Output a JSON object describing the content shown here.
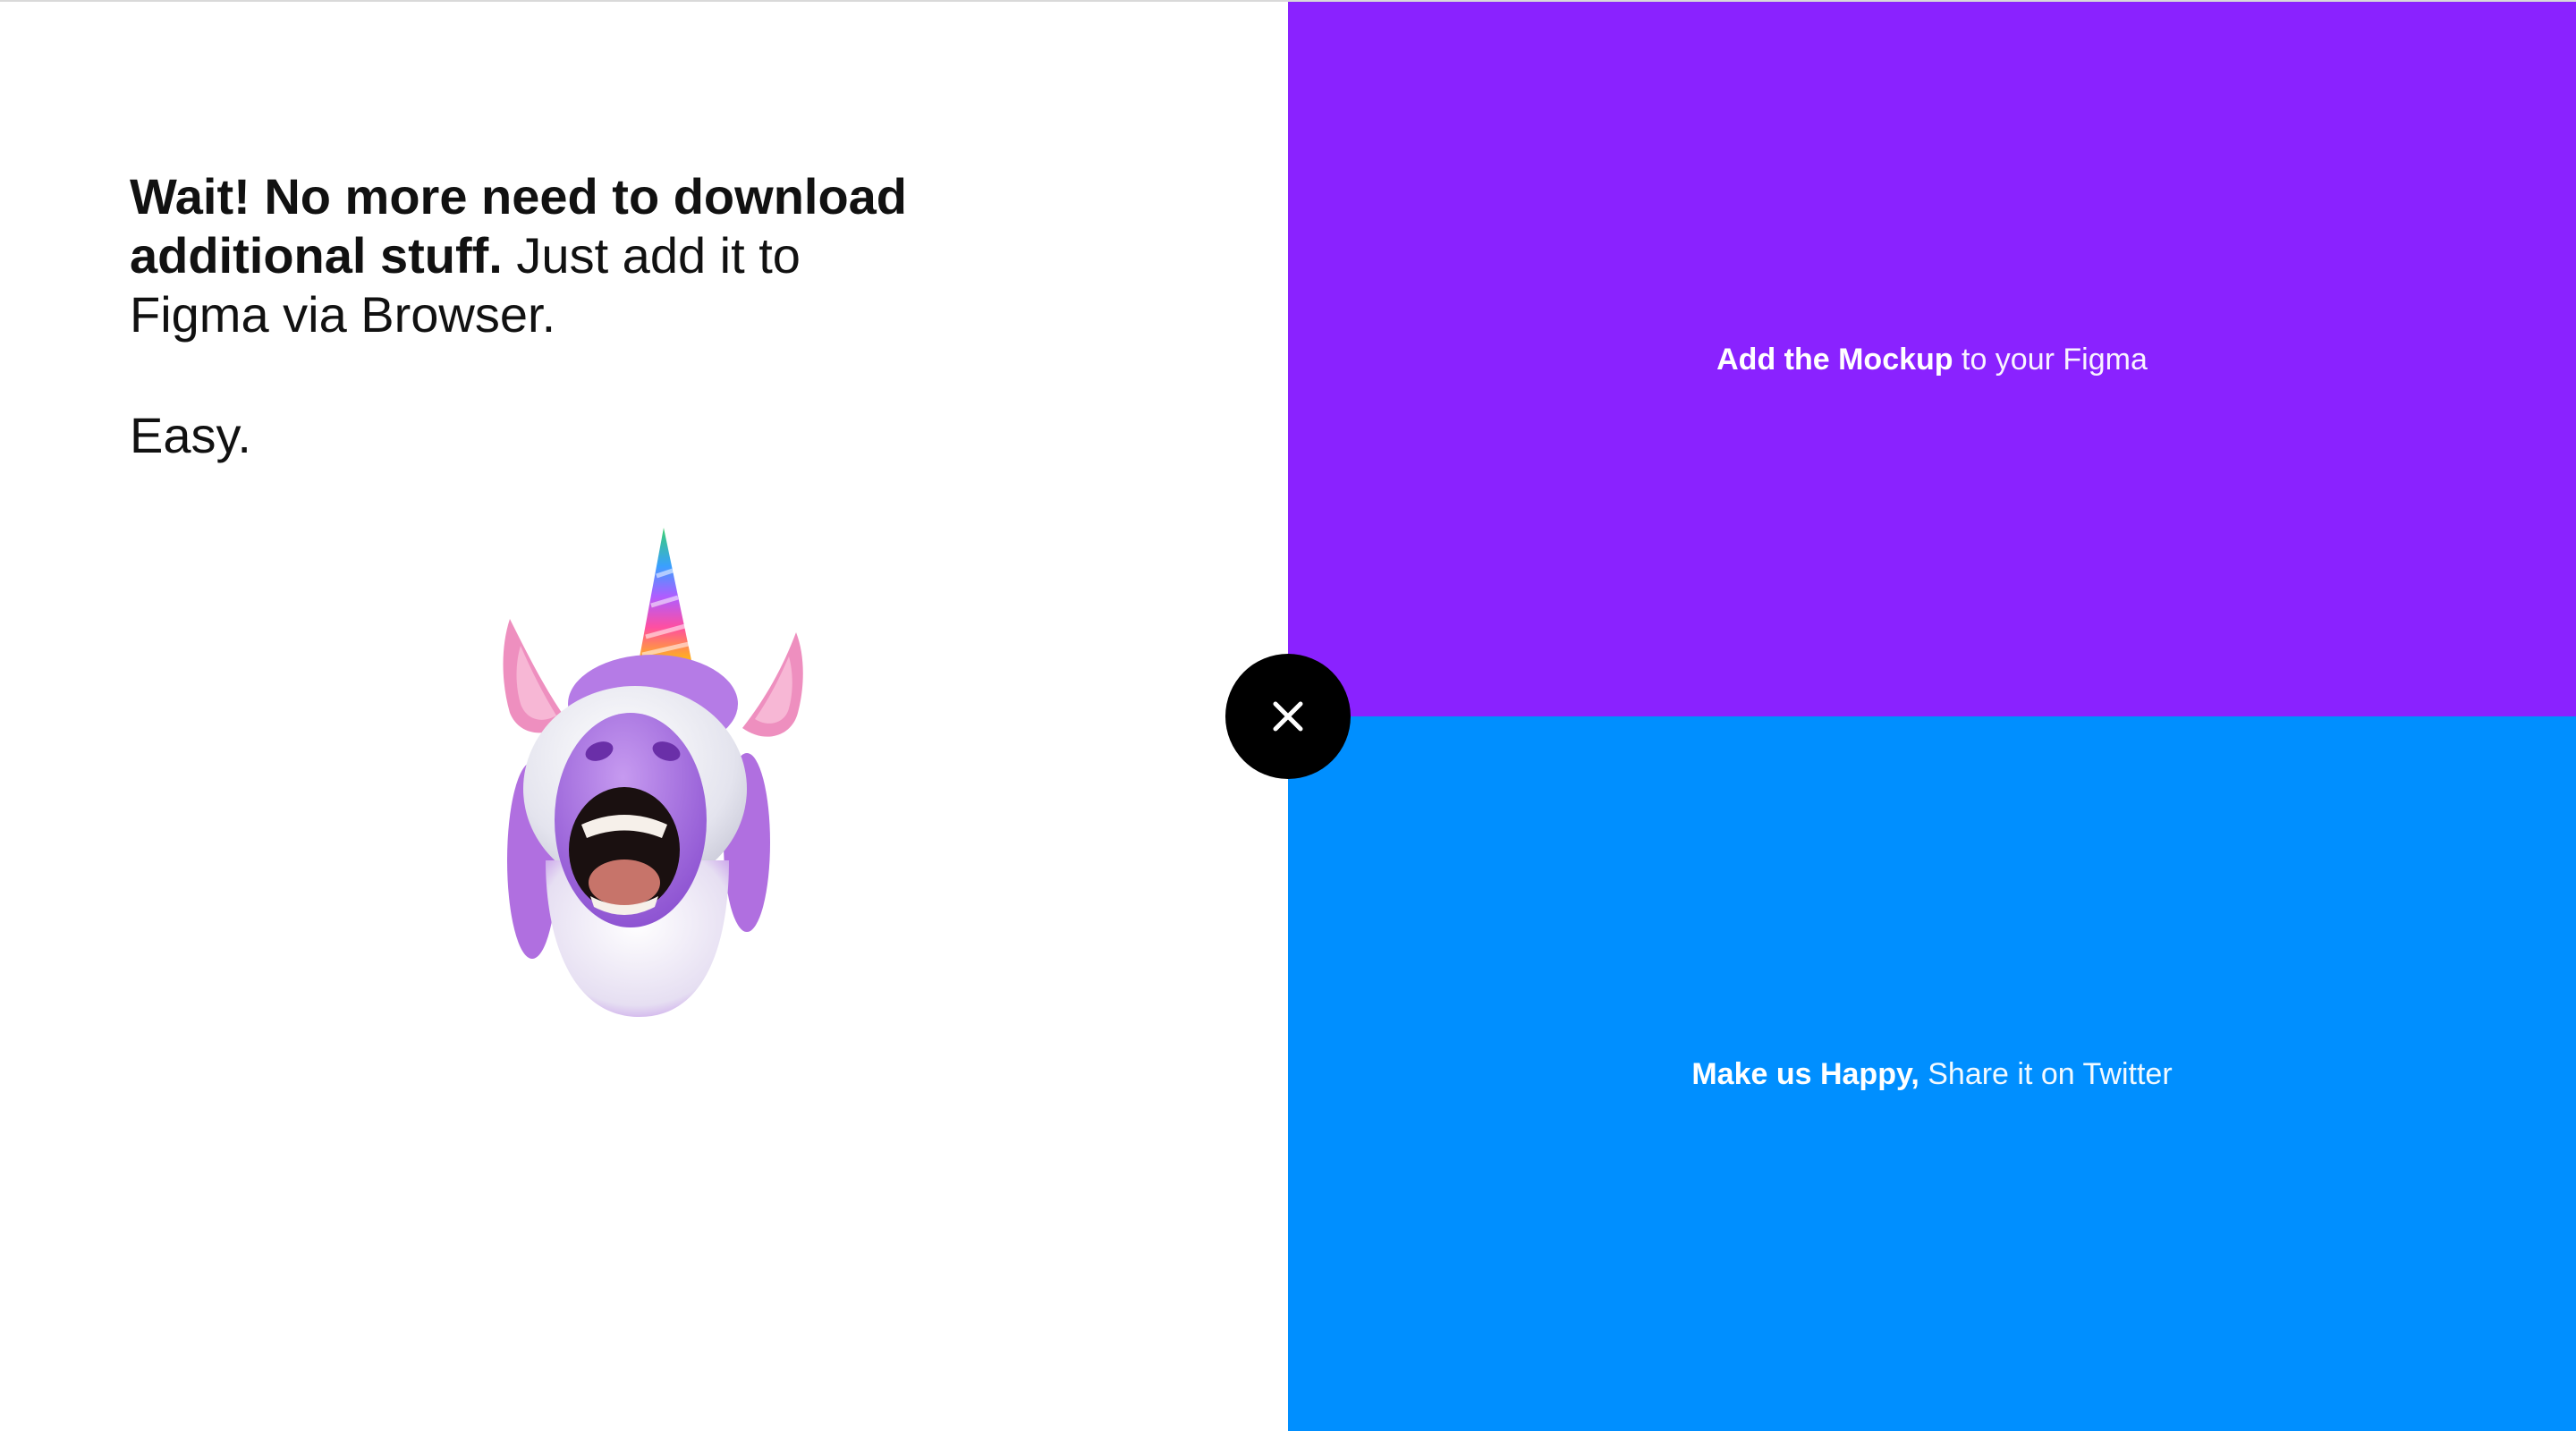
{
  "intro": {
    "headline_bold": "Wait! No more need to download additional stuff.",
    "headline_regular": " Just add it to Figma via Browser.",
    "easy": "Easy."
  },
  "cta_top": {
    "bold": "Add the Mockup",
    "regular": " to your Figma",
    "color": "#8a22ff"
  },
  "cta_bottom": {
    "bold": "Make us Happy,",
    "regular": " Share it on Twitter",
    "color": "#008fff"
  },
  "close": {
    "icon": "close-icon"
  },
  "mascot": {
    "icon": "unicorn-icon"
  }
}
